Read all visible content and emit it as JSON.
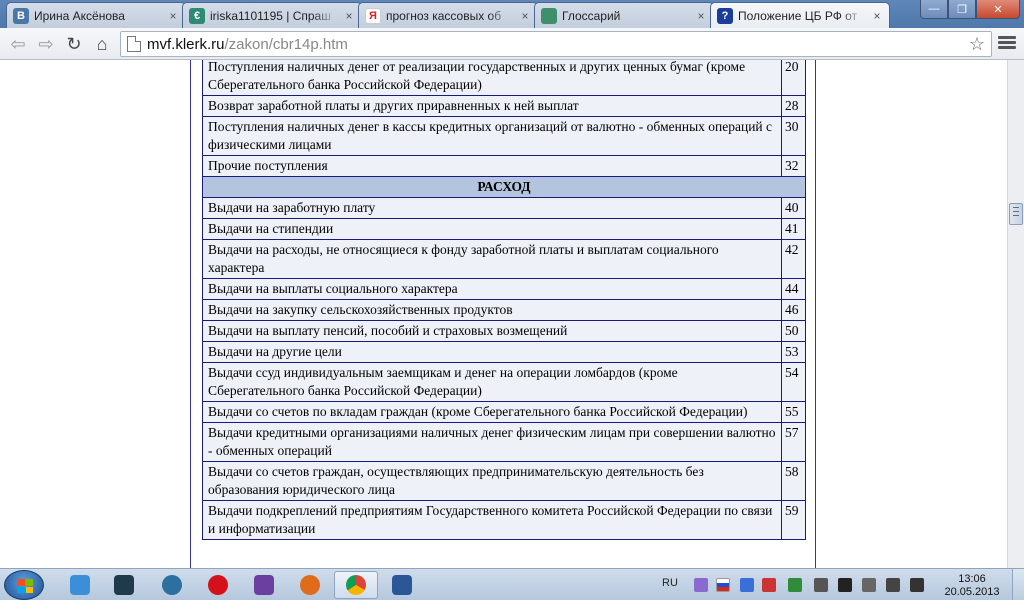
{
  "browser": {
    "tabs": [
      {
        "title": "Ирина Аксёнова",
        "icon": "vk-icon",
        "icon_glyph": "В",
        "icon_color": "#4a76a8"
      },
      {
        "title": "iriska1101195 | Спраш",
        "icon": "ask-icon",
        "icon_glyph": "€",
        "icon_color": "#2f8a73"
      },
      {
        "title": "прогноз кассовых об",
        "icon": "yandex-icon",
        "icon_glyph": "Я",
        "icon_color": "#ffffff"
      },
      {
        "title": "Глоссарий",
        "icon": "glossary-icon",
        "icon_glyph": "",
        "icon_color": "#3f8f6a"
      },
      {
        "title": "Положение ЦБ РФ от",
        "icon": "help-icon",
        "icon_glyph": "?",
        "icon_color": "#1c3c9a"
      }
    ],
    "active_tab": 4,
    "close_glyph": "×",
    "url_host": "mvf.klerk.ru",
    "url_path": "/zakon/cbr14p.htm"
  },
  "table": {
    "rows": [
      {
        "label": "Поступления наличных денег от реализации государственных и других ценных бумаг (кроме Сберегательного банка Российской Федерации)",
        "code": "20"
      },
      {
        "label": "Возврат заработной платы и других приравненных к ней выплат",
        "code": "28"
      },
      {
        "label": "Поступления наличных денег в кассы кредитных организаций от валютно - обменных операций с физическими лицами",
        "code": "30"
      },
      {
        "label": "Прочие поступления",
        "code": "32"
      },
      {
        "section": "РАСХОД"
      },
      {
        "label": "Выдачи на заработную плату",
        "code": "40"
      },
      {
        "label": "Выдачи на стипендии",
        "code": "41"
      },
      {
        "label": "Выдачи на расходы, не относящиеся к фонду заработной платы и выплатам социального характера",
        "code": "42"
      },
      {
        "label": "Выдачи на выплаты социального характера",
        "code": "44"
      },
      {
        "label": "Выдачи на закупку сельскохозяйственных продуктов",
        "code": "46"
      },
      {
        "label": "Выдачи на выплату пенсий, пособий и страховых возмещений",
        "code": "50"
      },
      {
        "label": "Выдачи на другие цели",
        "code": "53"
      },
      {
        "label": "Выдачи ссуд индивидуальным заемщикам и денег на операции ломбардов (кроме Сберегательного банка Российской Федерации)",
        "code": "54"
      },
      {
        "label": "Выдачи со счетов по вкладам граждан (кроме Сберегательного банка Российской Федерации)",
        "code": "55"
      },
      {
        "label": "Выдачи кредитными организациями наличных денег физическим лицам при совершении валютно - обменных операций",
        "code": "57"
      },
      {
        "label": "Выдачи со счетов граждан, осуществляющих предпринимательскую деятельность без образования юридического лица",
        "code": "58"
      },
      {
        "label": "Выдачи подкреплений предприятиям Государственного комитета Российской Федерации по связи и информатизации",
        "code": "59"
      }
    ]
  },
  "taskbar": {
    "apps": [
      {
        "name": "ie-icon",
        "color": "#3b8fd9",
        "active": false
      },
      {
        "name": "terminal-icon",
        "color": "#1f3a4a",
        "active": false
      },
      {
        "name": "media-player-icon",
        "color": "#2d6f9e",
        "active": false
      },
      {
        "name": "opera-icon",
        "color": "#d4111a",
        "active": false
      },
      {
        "name": "visual-studio-icon",
        "color": "#6b3fa0",
        "active": false
      },
      {
        "name": "firefox-icon",
        "color": "#e06c1b",
        "active": false
      },
      {
        "name": "chrome-icon",
        "color": "#3aa757",
        "active": true
      },
      {
        "name": "word-icon",
        "color": "#2b5797",
        "active": false
      }
    ],
    "language": "RU",
    "time": "13:06",
    "date": "20.05.2013"
  }
}
